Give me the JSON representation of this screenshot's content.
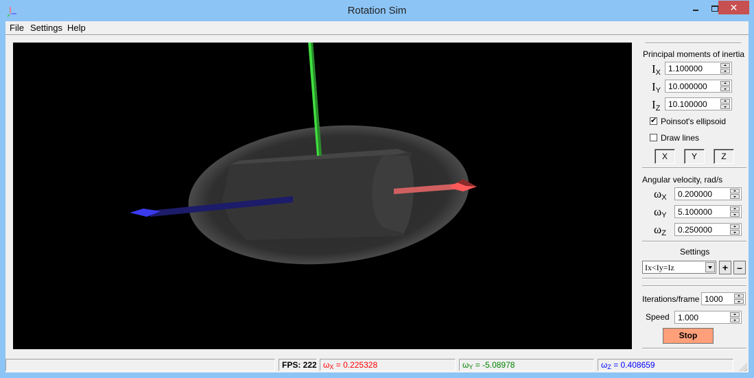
{
  "window": {
    "title": "Rotation Sim",
    "icon": "axes-app-icon",
    "controls": {
      "minimize": "minimize",
      "maximize": "maximize",
      "close": "✕"
    }
  },
  "menu": {
    "items": [
      {
        "label": "File"
      },
      {
        "label": "Settings"
      },
      {
        "label": "Help"
      }
    ]
  },
  "scene": {
    "description": "3D view of a gray cylinder inside a translucent Poinsot ellipsoid with axis arrows",
    "axes": [
      {
        "name": "x",
        "color": "#ff5a5a"
      },
      {
        "name": "y",
        "color": "#40e040"
      },
      {
        "name": "z",
        "color": "#2020a0"
      }
    ]
  },
  "panel": {
    "inertia": {
      "heading": "Principal moments of inertia",
      "fields": [
        {
          "symbol": "I",
          "sub": "X",
          "value": "1.100000"
        },
        {
          "symbol": "I",
          "sub": "Y",
          "value": "10.000000"
        },
        {
          "symbol": "I",
          "sub": "Z",
          "value": "10.100000"
        }
      ]
    },
    "poinsot": {
      "label": "Poinsot's ellipsoid",
      "checked": true,
      "mark": "✔"
    },
    "draw_lines": {
      "label": "Draw lines",
      "checked": false
    },
    "axis_buttons": [
      {
        "label": "X"
      },
      {
        "label": "Y"
      },
      {
        "label": "Z"
      }
    ],
    "velocity": {
      "heading": "Angular velocity, rad/s",
      "fields": [
        {
          "symbol": "ω",
          "sub": "X",
          "value": "0.200000"
        },
        {
          "symbol": "ω",
          "sub": "Y",
          "value": "5.100000"
        },
        {
          "symbol": "ω",
          "sub": "Z",
          "value": "0.250000"
        }
      ]
    },
    "settings": {
      "heading": "Settings",
      "preset": "Ix<Iy=Iz",
      "add_label": "+",
      "remove_label": "–"
    },
    "iterations": {
      "label": "Iterations/frame",
      "value": "1000"
    },
    "speed": {
      "label": "Speed",
      "value": "1.000"
    },
    "stop_label": "Stop",
    "stop_color": "#ffa07a"
  },
  "statusbar": {
    "message": "",
    "fps": "FPS: 222",
    "wx": {
      "symbol": "ω",
      "sub": "X",
      "text": " = 0.225328",
      "color": "#ff0000"
    },
    "wy": {
      "symbol": "ω",
      "sub": "Y",
      "text": " = -5.08978",
      "color": "#008000"
    },
    "wz": {
      "symbol": "ω",
      "sub": "Z",
      "text": " = 0.408659",
      "color": "#0000ff"
    }
  }
}
